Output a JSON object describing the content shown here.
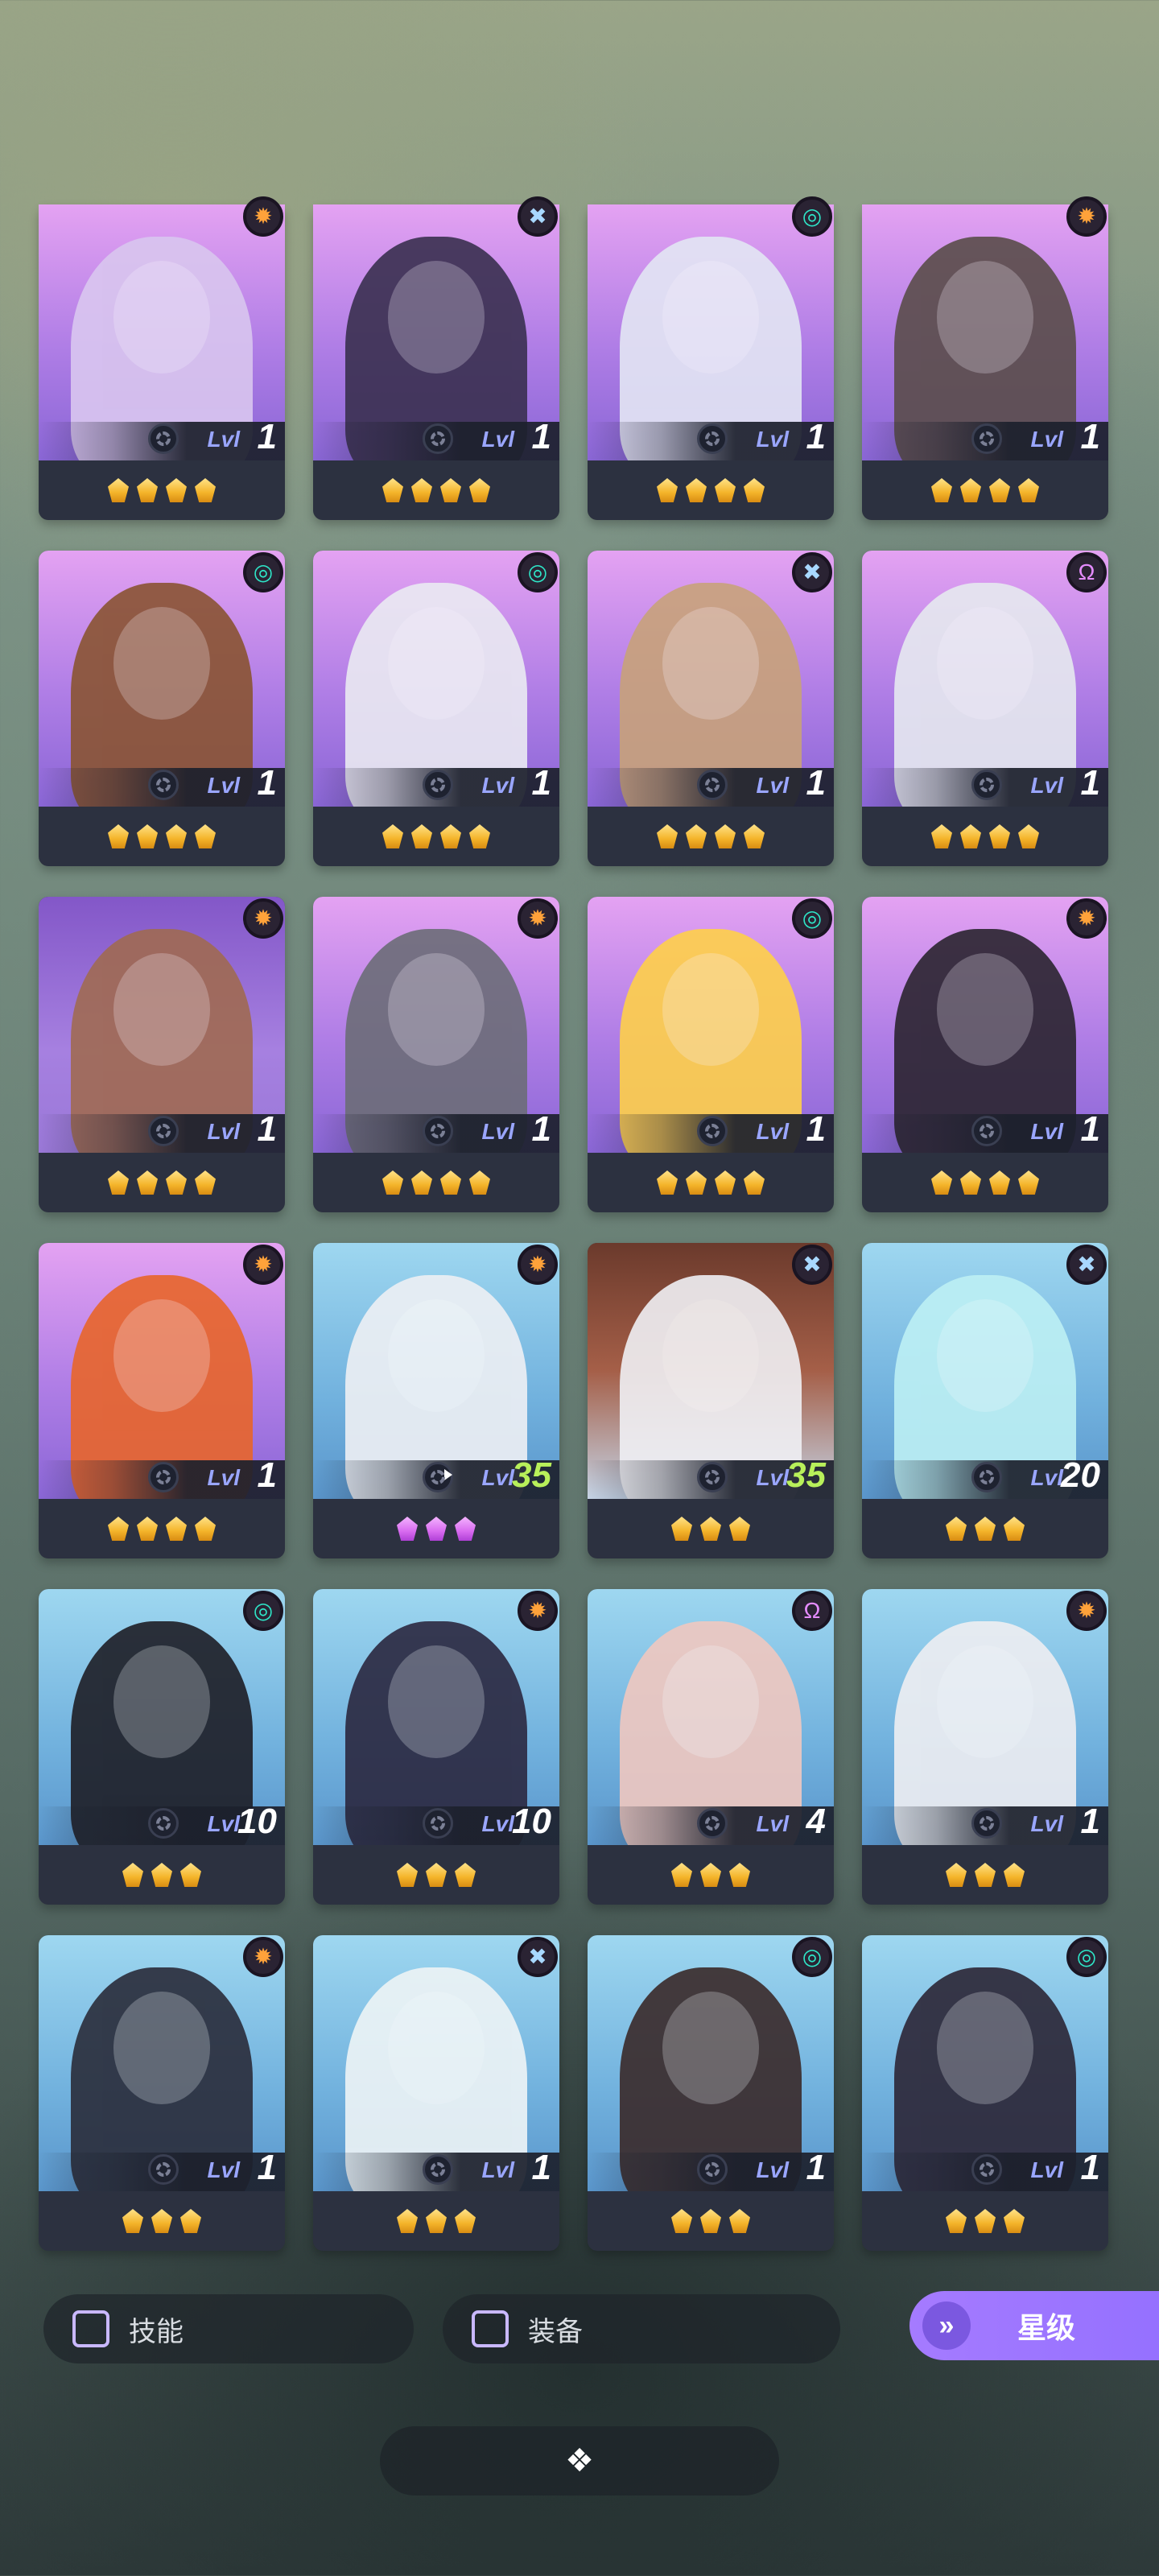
{
  "icons": {
    "sun": "✹",
    "swirl": "◎",
    "cross": "✖",
    "omega": "Ω"
  },
  "heroes": [
    {
      "bg": "purple",
      "element": "sun",
      "lvl_label": "Lvl",
      "level": "1",
      "stars": 4,
      "star_color": "gold",
      "skin": "#d9c6ef"
    },
    {
      "bg": "purple",
      "element": "cross",
      "lvl_label": "Lvl",
      "level": "1",
      "stars": 4,
      "star_color": "gold",
      "skin": "#3a3050"
    },
    {
      "bg": "purple",
      "element": "swirl",
      "lvl_label": "Lvl",
      "level": "1",
      "stars": 4,
      "star_color": "gold",
      "skin": "#e3e6f4"
    },
    {
      "bg": "purple",
      "element": "sun",
      "lvl_label": "Lvl",
      "level": "1",
      "stars": 4,
      "star_color": "gold",
      "skin": "#5a4d4a"
    },
    {
      "bg": "purple",
      "element": "swirl",
      "lvl_label": "Lvl",
      "level": "1",
      "stars": 4,
      "star_color": "gold",
      "skin": "#8a5432"
    },
    {
      "bg": "purple",
      "element": "swirl",
      "lvl_label": "Lvl",
      "level": "1",
      "stars": 4,
      "star_color": "gold",
      "skin": "#eaeaf2"
    },
    {
      "bg": "purple",
      "element": "cross",
      "lvl_label": "Lvl",
      "level": "1",
      "stars": 4,
      "star_color": "gold",
      "skin": "#c8a27a"
    },
    {
      "bg": "purple",
      "element": "omega",
      "lvl_label": "Lvl",
      "level": "1",
      "stars": 4,
      "star_color": "gold",
      "skin": "#e6e9ef"
    },
    {
      "bg": "indigo",
      "element": "sun",
      "lvl_label": "Lvl",
      "level": "1",
      "stars": 4,
      "star_color": "gold",
      "skin": "#a06a52"
    },
    {
      "bg": "purple",
      "element": "sun",
      "lvl_label": "Lvl",
      "level": "1",
      "stars": 4,
      "star_color": "gold",
      "skin": "#6c6d78"
    },
    {
      "bg": "purple",
      "element": "swirl",
      "lvl_label": "Lvl",
      "level": "1",
      "stars": 4,
      "star_color": "gold",
      "skin": "#ffd04a"
    },
    {
      "bg": "purple",
      "element": "sun",
      "lvl_label": "Lvl",
      "level": "1",
      "stars": 4,
      "star_color": "gold",
      "skin": "#2b2530"
    },
    {
      "bg": "purple",
      "element": "sun",
      "lvl_label": "Lvl",
      "level": "1",
      "stars": 4,
      "star_color": "gold",
      "skin": "#e8652a"
    },
    {
      "bg": "blue",
      "element": "sun",
      "lvl_label": "Lvl",
      "level": "35",
      "stars": 3,
      "star_color": "pink",
      "skin": "#eef0f4"
    },
    {
      "bg": "brown",
      "element": "cross",
      "lvl_label": "Lvl",
      "level": "35",
      "stars": 3,
      "star_color": "gold",
      "skin": "#f0f0f4"
    },
    {
      "bg": "blue",
      "element": "cross",
      "lvl_label": "Lvl",
      "level": "20",
      "stars": 3,
      "star_color": "gold",
      "skin": "#bdf0f4"
    },
    {
      "bg": "blue",
      "element": "swirl",
      "lvl_label": "Lvl",
      "level": "10",
      "stars": 3,
      "star_color": "gold",
      "skin": "#1e1e26"
    },
    {
      "bg": "blue",
      "element": "sun",
      "lvl_label": "Lvl",
      "level": "10",
      "stars": 3,
      "star_color": "gold",
      "skin": "#2b2840"
    },
    {
      "bg": "blue",
      "element": "omega",
      "lvl_label": "Lvl",
      "level": "4",
      "stars": 3,
      "star_color": "gold",
      "skin": "#f0c8c0"
    },
    {
      "bg": "blue",
      "element": "sun",
      "lvl_label": "Lvl",
      "level": "1",
      "stars": 3,
      "star_color": "gold",
      "skin": "#eeeef2"
    },
    {
      "bg": "blue",
      "element": "sun",
      "lvl_label": "Lvl",
      "level": "1",
      "stars": 3,
      "star_color": "gold",
      "skin": "#2a2c3a"
    },
    {
      "bg": "blue",
      "element": "cross",
      "lvl_label": "Lvl",
      "level": "1",
      "stars": 3,
      "star_color": "gold",
      "skin": "#eef4f6"
    },
    {
      "bg": "blue",
      "element": "swirl",
      "lvl_label": "Lvl",
      "level": "1",
      "stars": 3,
      "star_color": "gold",
      "skin": "#3a2a2a"
    },
    {
      "bg": "blue",
      "element": "swirl",
      "lvl_label": "Lvl",
      "level": "1",
      "stars": 3,
      "star_color": "gold",
      "skin": "#2c2636"
    }
  ],
  "filters": {
    "skill_label": "技能",
    "equipment_label": "装备"
  },
  "sort": {
    "label": "星级",
    "chevron": "»"
  },
  "drawer_handle": {
    "icon": "❖"
  }
}
